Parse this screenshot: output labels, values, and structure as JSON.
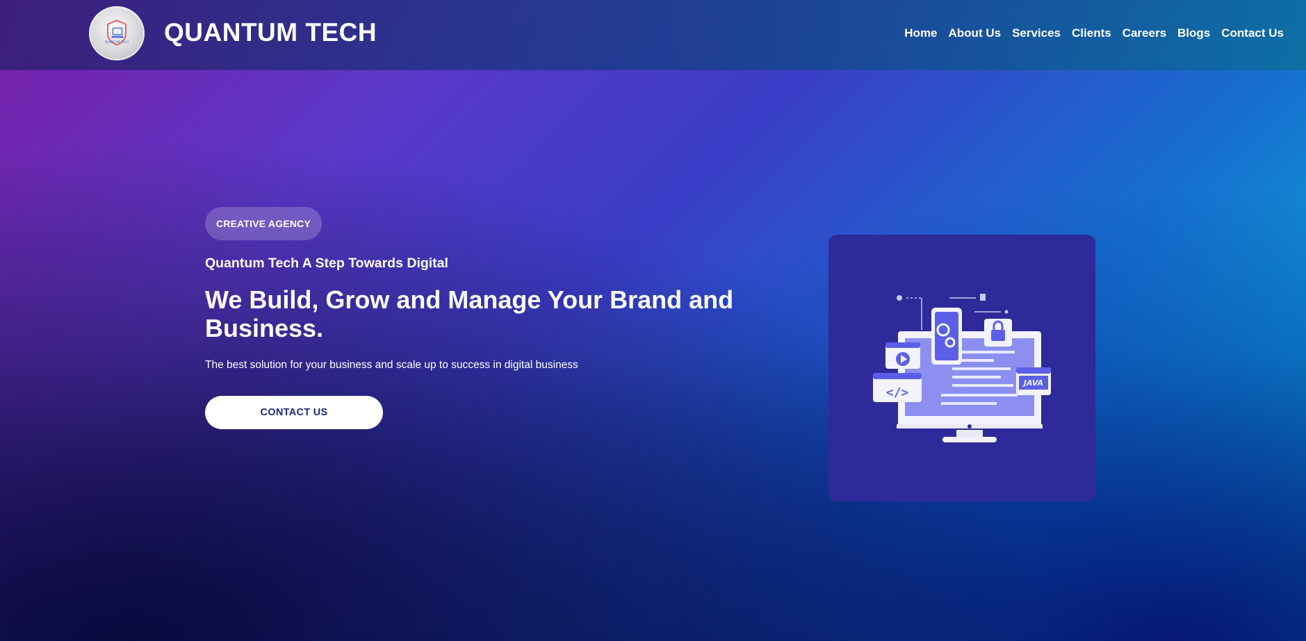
{
  "header": {
    "brand": "QUANTUM TECH",
    "logo_text": "QUANTUM TECH"
  },
  "nav": {
    "items": [
      "Home",
      "About Us",
      "Services",
      "Clients",
      "Careers",
      "Blogs",
      "Contact Us"
    ]
  },
  "hero": {
    "badge": "CREATIVE AGENCY",
    "tagline": "Quantum Tech A Step Towards Digital",
    "headline": "We Build, Grow and Manage Your Brand and Business.",
    "subtext": "The best solution for your business and scale up to success in digital business",
    "cta_label": "CONTACT US"
  },
  "illustration": {
    "java_label": "JAVA",
    "code_label": "</>"
  },
  "colors": {
    "accent_dark": "#1e2a78",
    "card_bg": "#2e2a9a",
    "illustration_accent": "#5b5fe6"
  }
}
